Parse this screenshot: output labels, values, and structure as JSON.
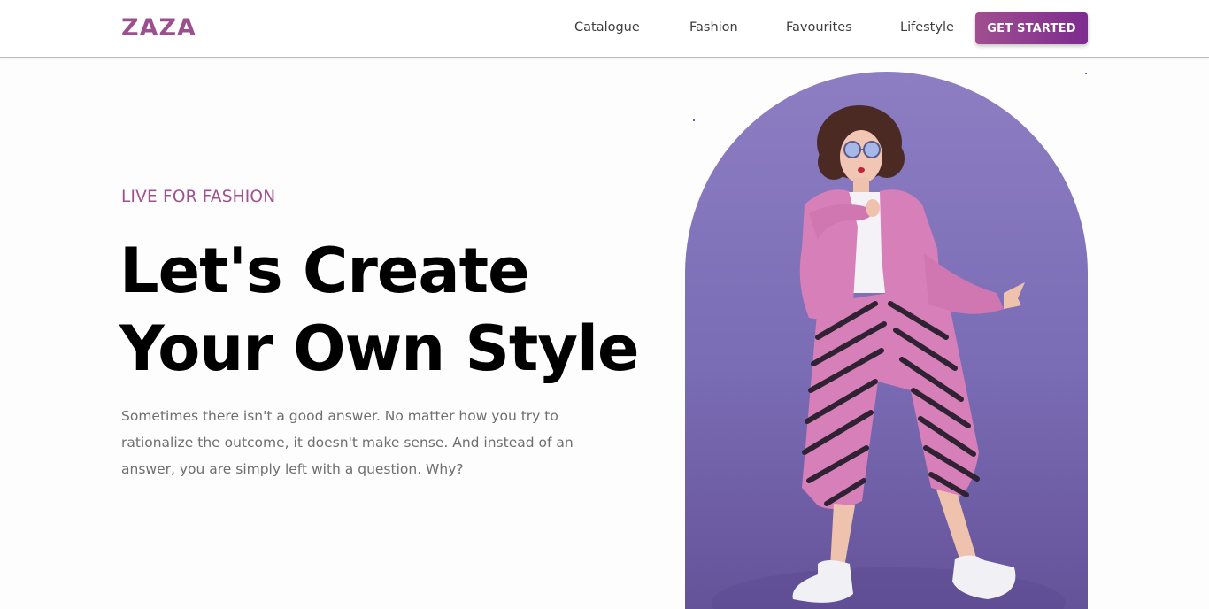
{
  "brand": {
    "name": "ZAZA",
    "color": "#9b4f8e"
  },
  "nav": {
    "links": [
      "Catalogue",
      "Fashion",
      "Favourites",
      "Lifestyle"
    ],
    "cta_label": "GET STARTED"
  },
  "hero": {
    "eyebrow": "LIVE FOR FASHION",
    "headline_line1": "Let's Create",
    "headline_line2": "Your Own Style",
    "description": "Sometimes there isn't a good answer. No matter how you try to rationalize the outcome, it doesn't make sense. And instead of an answer, you are simply left with a question. Why?",
    "accent_color": "#a04f8f",
    "image_background": "#8d7ec3"
  }
}
